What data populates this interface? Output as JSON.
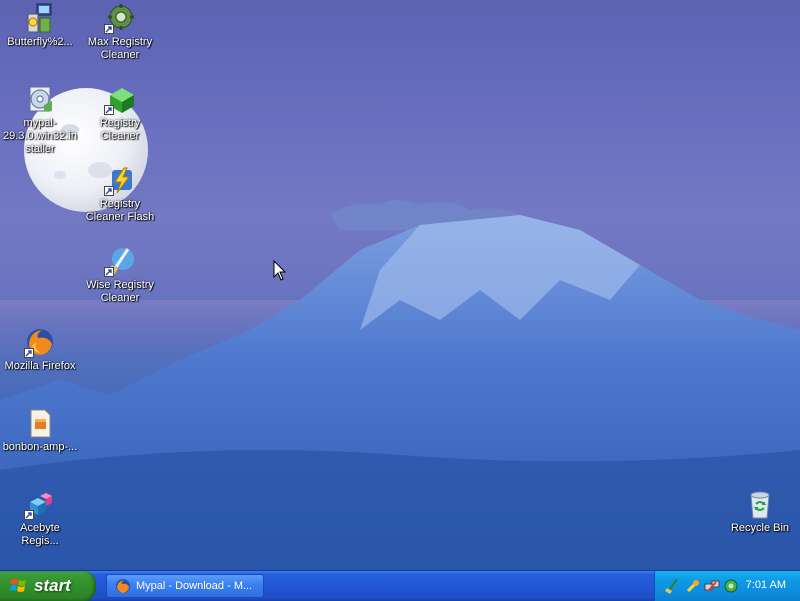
{
  "desktop": {
    "icons": [
      {
        "name": "butterfly-installer",
        "label": "Butterfly%2...",
        "icon": "installer-icon"
      },
      {
        "name": "max-registry-cleaner",
        "label": "Max Registry Cleaner",
        "icon": "gear-icon"
      },
      {
        "name": "mypal-installer",
        "label": "mypal-29.3.0.win32.installer",
        "icon": "disc-installer-icon"
      },
      {
        "name": "registry-cleaner",
        "label": "Registry Cleaner",
        "icon": "green-cube-icon"
      },
      {
        "name": "registry-cleaner-flash",
        "label": "Registry Cleaner Flash",
        "icon": "lightning-icon"
      },
      {
        "name": "wise-registry-cleaner",
        "label": "Wise Registry Cleaner",
        "icon": "broom-icon"
      },
      {
        "name": "mozilla-firefox",
        "label": "Mozilla Firefox",
        "icon": "firefox-icon"
      },
      {
        "name": "bonbon-amp",
        "label": "bonbon-amp-...",
        "icon": "document-icon"
      },
      {
        "name": "acebyte-registry",
        "label": "Acebyte Regis...",
        "icon": "cubes-icon"
      },
      {
        "name": "recycle-bin",
        "label": "Recycle Bin",
        "icon": "recycle-bin-icon"
      }
    ]
  },
  "taskbar": {
    "start_label": "start",
    "task_label": "Mypal - Download - M...",
    "clock": "7:01 AM"
  },
  "colors": {
    "taskbar": "#245edb",
    "start": "#3c9a36",
    "tray": "#0f9ae6"
  }
}
